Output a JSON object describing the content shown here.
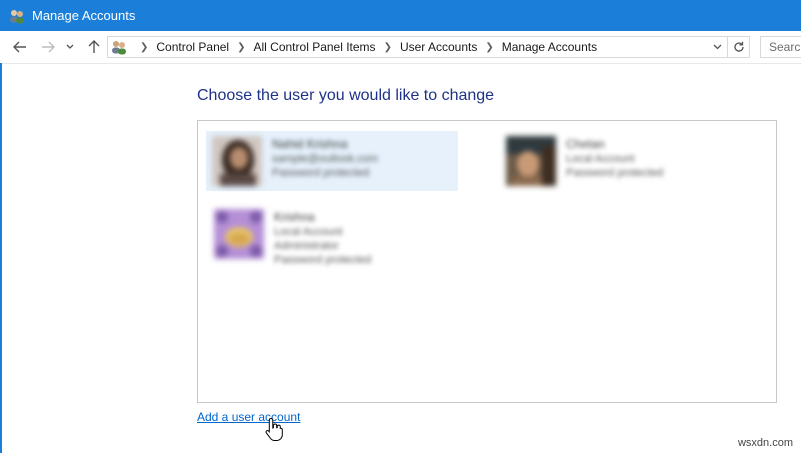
{
  "window": {
    "title": "Manage Accounts",
    "accent_color": "#1b7fd9",
    "icon": "users-icon"
  },
  "nav": {
    "back_icon": "back-arrow-icon",
    "forward_icon": "forward-arrow-icon",
    "recent_icon": "chevron-down-icon",
    "up_icon": "up-arrow-icon",
    "breadcrumbs": [
      "Control Panel",
      "All Control Panel Items",
      "User Accounts",
      "Manage Accounts"
    ],
    "search_placeholder": "Search"
  },
  "main": {
    "heading": "Choose the user you would like to change",
    "accounts": [
      {
        "name": "Nahid Krishna",
        "lines": [
          "sample@outlook.com",
          "Password protected"
        ],
        "selected": true
      },
      {
        "name": "Chetan",
        "lines": [
          "Local Account",
          "Password protected"
        ],
        "selected": false
      },
      {
        "name": "Krishna",
        "lines": [
          "Local Account",
          "Administrator",
          "Password protected"
        ],
        "selected": false
      }
    ],
    "add_link": "Add a user account"
  },
  "watermark": "wsxdn.com"
}
